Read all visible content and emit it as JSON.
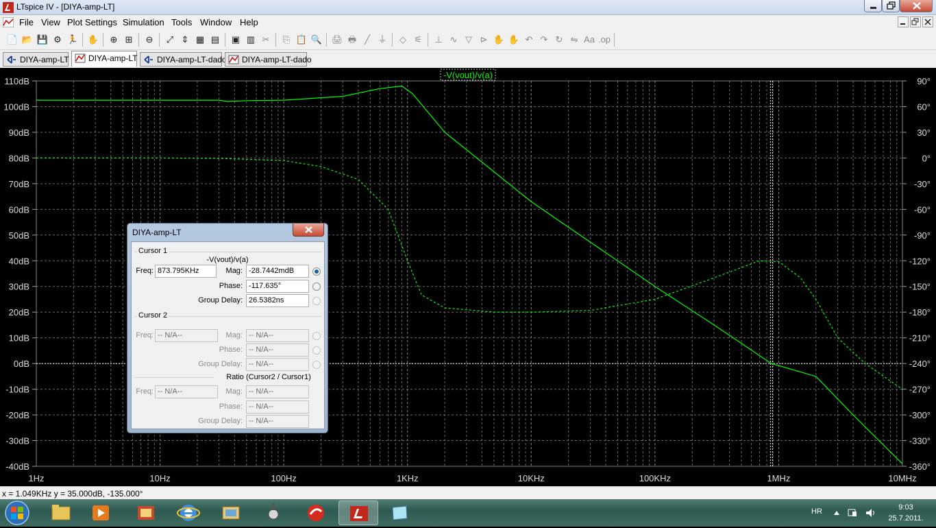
{
  "window": {
    "title": "LTspice IV - [DIYA-amp-LT]"
  },
  "menu": [
    "File",
    "View",
    "Plot Settings",
    "Simulation",
    "Tools",
    "Window",
    "Help"
  ],
  "toolbar_icons": [
    "new-schematic-icon",
    "open-icon",
    "save-icon",
    "control-panel-icon",
    "run-icon",
    "pan-icon",
    "zoom-in-icon",
    "zoom-area-icon",
    "zoom-out-icon",
    "zoom-fit-icon",
    "autorange-icon",
    "grid-icon",
    "tile-horizontal-icon",
    "cascade-icon",
    "tile-vertical-icon",
    "cut-icon",
    "copy-icon",
    "paste-icon",
    "find-icon",
    "print-setup-icon",
    "print-icon",
    "wire-icon",
    "ground-icon",
    "label-icon",
    "resistor-icon",
    "capacitor-icon",
    "inductor-icon",
    "diode-icon",
    "component-icon",
    "move-icon",
    "drag-icon",
    "undo-icon",
    "redo-icon",
    "rotate-icon",
    "mirror-icon",
    "text-icon",
    "spice-directive-icon"
  ],
  "tabs": [
    {
      "label": "DIYA-amp-LT",
      "kind": "schematic"
    },
    {
      "label": "DIYA-amp-LT",
      "kind": "waveform"
    },
    {
      "label": "DIYA-amp-LT-dado",
      "kind": "schematic"
    },
    {
      "label": "DIYA-amp-LT-dado",
      "kind": "waveform"
    }
  ],
  "chart_data": {
    "type": "line",
    "trace_label": "-V(vout)/v(a)",
    "x_scale": "log",
    "x_ticks": [
      "1Hz",
      "10Hz",
      "100Hz",
      "1KHz",
      "10KHz",
      "100KHz",
      "1MHz",
      "10MHz"
    ],
    "x_range": [
      1,
      10000000
    ],
    "left_ticks": [
      "110dB",
      "100dB",
      "90dB",
      "80dB",
      "70dB",
      "60dB",
      "50dB",
      "40dB",
      "30dB",
      "20dB",
      "10dB",
      "0dB",
      "-10dB",
      "-20dB",
      "-30dB",
      "-40dB"
    ],
    "left_range": [
      -40,
      110
    ],
    "right_ticks": [
      "90°",
      "60°",
      "30°",
      "0°",
      "-30°",
      "-60°",
      "-90°",
      "-120°",
      "-150°",
      "-180°",
      "-210°",
      "-240°",
      "-270°",
      "-300°",
      "-330°",
      "-360°"
    ],
    "right_range": [
      -360,
      90
    ],
    "grid": true,
    "color": "#00ff00",
    "series": [
      {
        "style": "solid",
        "x": [
          1,
          3,
          10,
          30,
          35,
          50,
          100,
          300,
          600,
          900,
          1100,
          2000,
          10000,
          100000,
          300000,
          873795,
          2000000,
          4000000,
          10000000
        ],
        "y": [
          102.5,
          102.5,
          102.5,
          102.5,
          102,
          102.3,
          102.5,
          104,
          107,
          108,
          105,
          90,
          63,
          30,
          15,
          -0.03,
          -5,
          -20,
          -39
        ]
      },
      {
        "style": "dashed",
        "x": [
          1,
          10,
          30,
          100,
          200,
          400,
          700,
          1000,
          1300,
          2000,
          5000,
          10000,
          30000,
          100000,
          300000,
          700000,
          1000000,
          1500000,
          2000000,
          3000000,
          5000000,
          10000000
        ],
        "y": [
          0,
          0,
          -0.5,
          -3,
          -10,
          -25,
          -60,
          -120,
          -160,
          -175,
          -180,
          -180,
          -178,
          -165,
          -140,
          -120,
          -121,
          -140,
          -165,
          -210,
          -240,
          -270
        ]
      }
    ],
    "cursor_x": 873795,
    "cursor_y": 0
  },
  "status": {
    "text": "x = 1.049KHz   y = 35.000dB, -135.000°"
  },
  "dialog": {
    "title": "DIYA-amp-LT",
    "cursor1_label": "Cursor 1",
    "cursor2_label": "Cursor 2",
    "expression": "-V(vout)/v(a)",
    "ratio_label": "Ratio (Cursor2 / Cursor1)",
    "freq_label": "Freq:",
    "mag_label": "Mag:",
    "phase_label": "Phase:",
    "delay_label": "Group Delay:",
    "c1": {
      "freq": "873.795KHz",
      "mag": "-28.7442mdB",
      "phase": "-117.635°",
      "delay": "26.5382ns"
    },
    "na": "-- N/A--"
  },
  "taskbar": {
    "lang": "HR",
    "time": "9:03",
    "date": "25.7.2011."
  }
}
